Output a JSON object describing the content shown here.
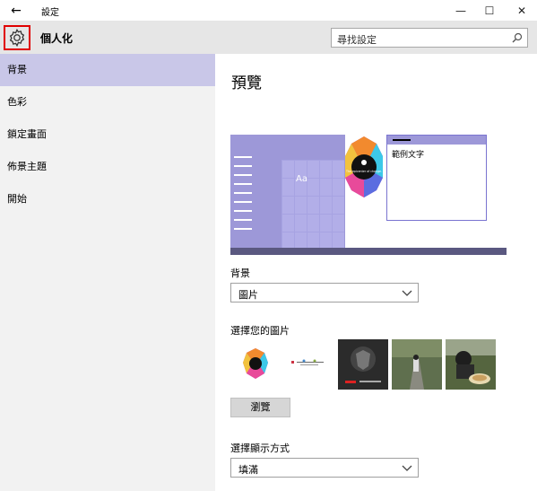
{
  "window": {
    "title": "設定",
    "back_glyph": "←",
    "min_glyph": "—",
    "max_glyph": "☐",
    "close_glyph": "✕"
  },
  "header": {
    "title": "個人化",
    "search_placeholder": "尋找設定"
  },
  "sidebar": {
    "items": [
      {
        "label": "背景",
        "active": true
      },
      {
        "label": "色彩",
        "active": false
      },
      {
        "label": "鎖定畫面",
        "active": false
      },
      {
        "label": "佈景主題",
        "active": false
      },
      {
        "label": "開始",
        "active": false
      }
    ]
  },
  "main": {
    "preview_title": "預覽",
    "preview": {
      "tile_label": "Aa",
      "sample_text": "範例文字",
      "wallpaper_text": "The epicenter of change."
    },
    "background": {
      "label": "背景",
      "value": "圖片"
    },
    "choose_picture": {
      "label": "選擇您的圖片",
      "browse_label": "瀏覽"
    },
    "fit": {
      "label": "選擇顯示方式",
      "value": "填滿"
    }
  },
  "colors": {
    "accent": "#9d98d8",
    "sidebar_active": "#c9c7e8",
    "highlight_border": "#e00000"
  }
}
